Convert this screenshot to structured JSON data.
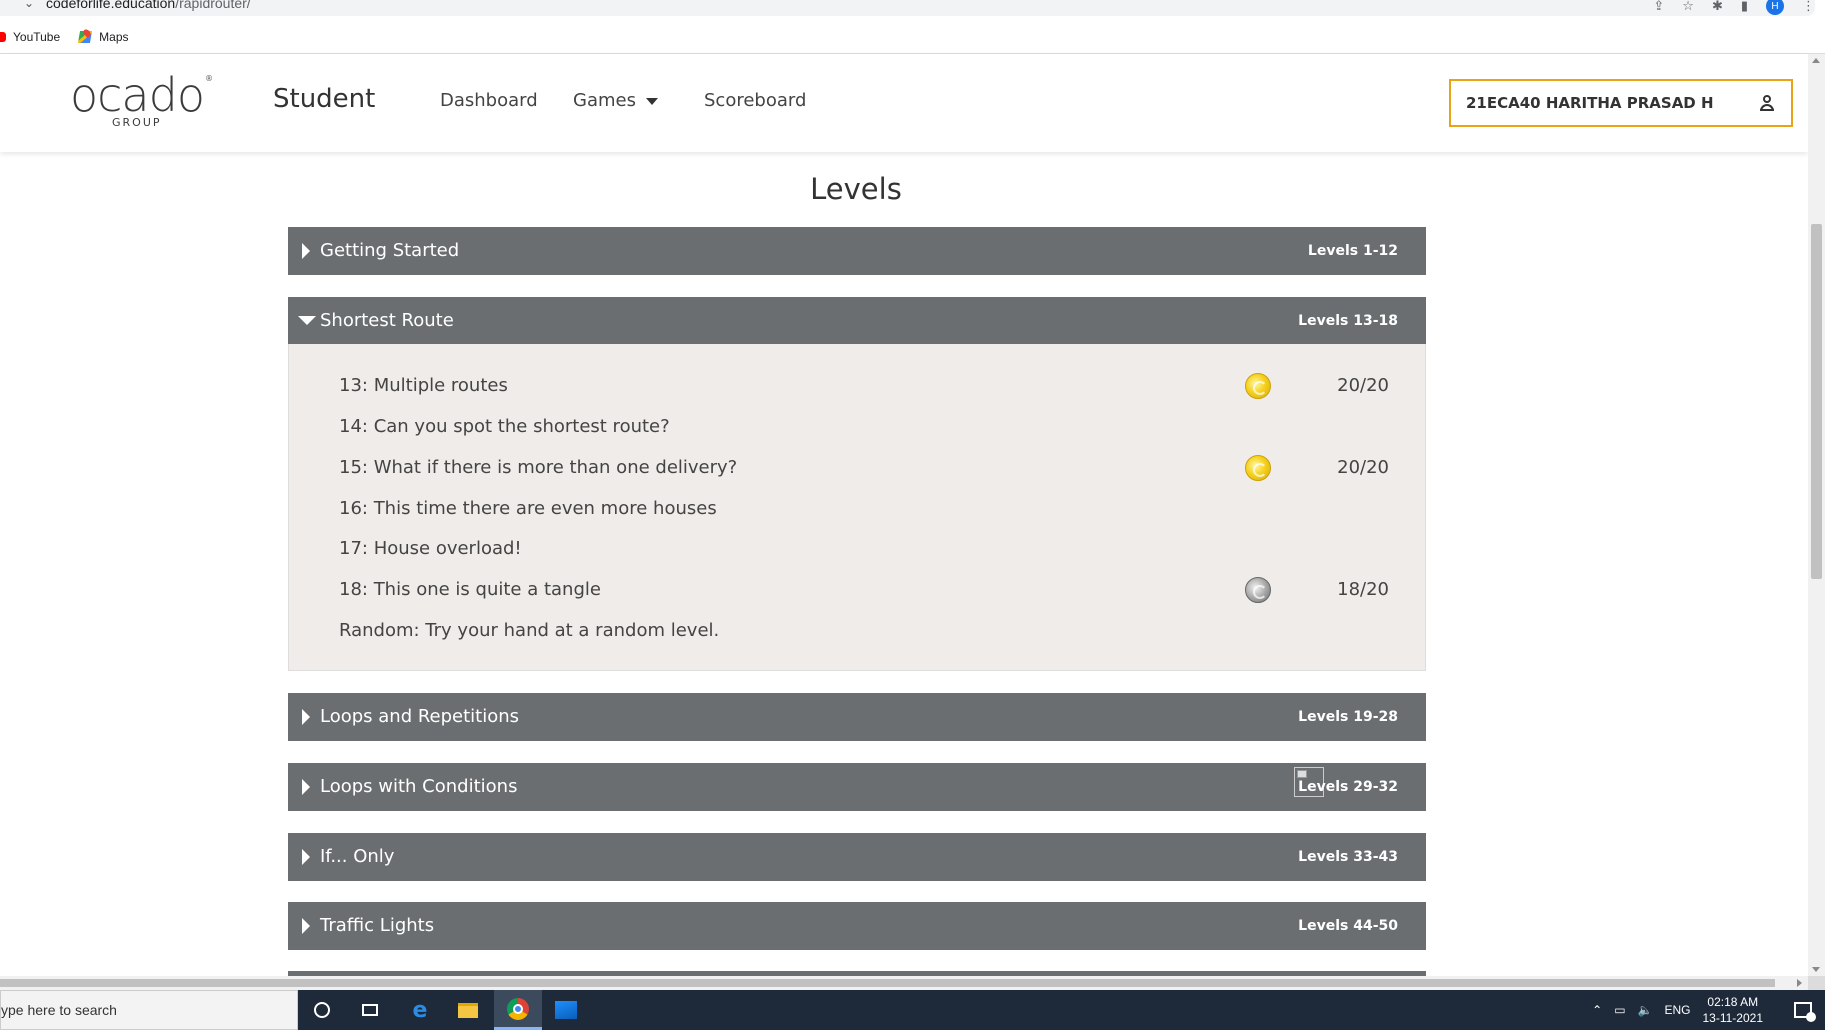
{
  "browser": {
    "url_host": "codeforlife.education",
    "url_path": "/rapidrouter/",
    "profile_initial": "H",
    "bookmarks": [
      {
        "label": "YouTube",
        "icon": "youtube-icon"
      },
      {
        "label": "Maps",
        "icon": "maps-icon"
      }
    ]
  },
  "header": {
    "logo_word": "ocado",
    "logo_sub": "GROUP",
    "brand": "Student",
    "nav": {
      "dashboard": "Dashboard",
      "games": "Games",
      "scoreboard": "Scoreboard"
    },
    "user_name": "21ECA40 HARITHA PRASAD H"
  },
  "main": {
    "title": "Levels",
    "episodes": [
      {
        "name": "Getting Started",
        "range": "Levels 1-12",
        "expanded": false
      },
      {
        "name": "Shortest Route",
        "range": "Levels 13-18",
        "expanded": true
      },
      {
        "name": "Loops and Repetitions",
        "range": "Levels 19-28",
        "expanded": false
      },
      {
        "name": "Loops with Conditions",
        "range": "Levels 29-32",
        "expanded": false
      },
      {
        "name": "If... Only",
        "range": "Levels 33-43",
        "expanded": false
      },
      {
        "name": "Traffic Lights",
        "range": "Levels 44-50",
        "expanded": false
      }
    ],
    "levels": [
      {
        "name": "13: Multiple routes",
        "medal": "gold",
        "score": "20/20"
      },
      {
        "name": "14: Can you spot the shortest route?",
        "medal": "",
        "score": ""
      },
      {
        "name": "15: What if there is more than one delivery?",
        "medal": "gold",
        "score": "20/20"
      },
      {
        "name": "16: This time there are even more houses",
        "medal": "",
        "score": ""
      },
      {
        "name": "17: House overload!",
        "medal": "",
        "score": ""
      },
      {
        "name": "18: This one is quite a tangle",
        "medal": "silver",
        "score": "18/20"
      },
      {
        "name": "Random: Try your hand at a random level.",
        "medal": "",
        "score": ""
      }
    ]
  },
  "taskbar": {
    "search_placeholder": "ype here to search",
    "language": "ENG",
    "time": "02:18 AM",
    "date": "13-11-2021"
  },
  "colors": {
    "episode_bar": "#6b6e70",
    "panel_bg": "#efecea",
    "user_border": "#e8a317",
    "taskbar": "#1e2a3a"
  }
}
